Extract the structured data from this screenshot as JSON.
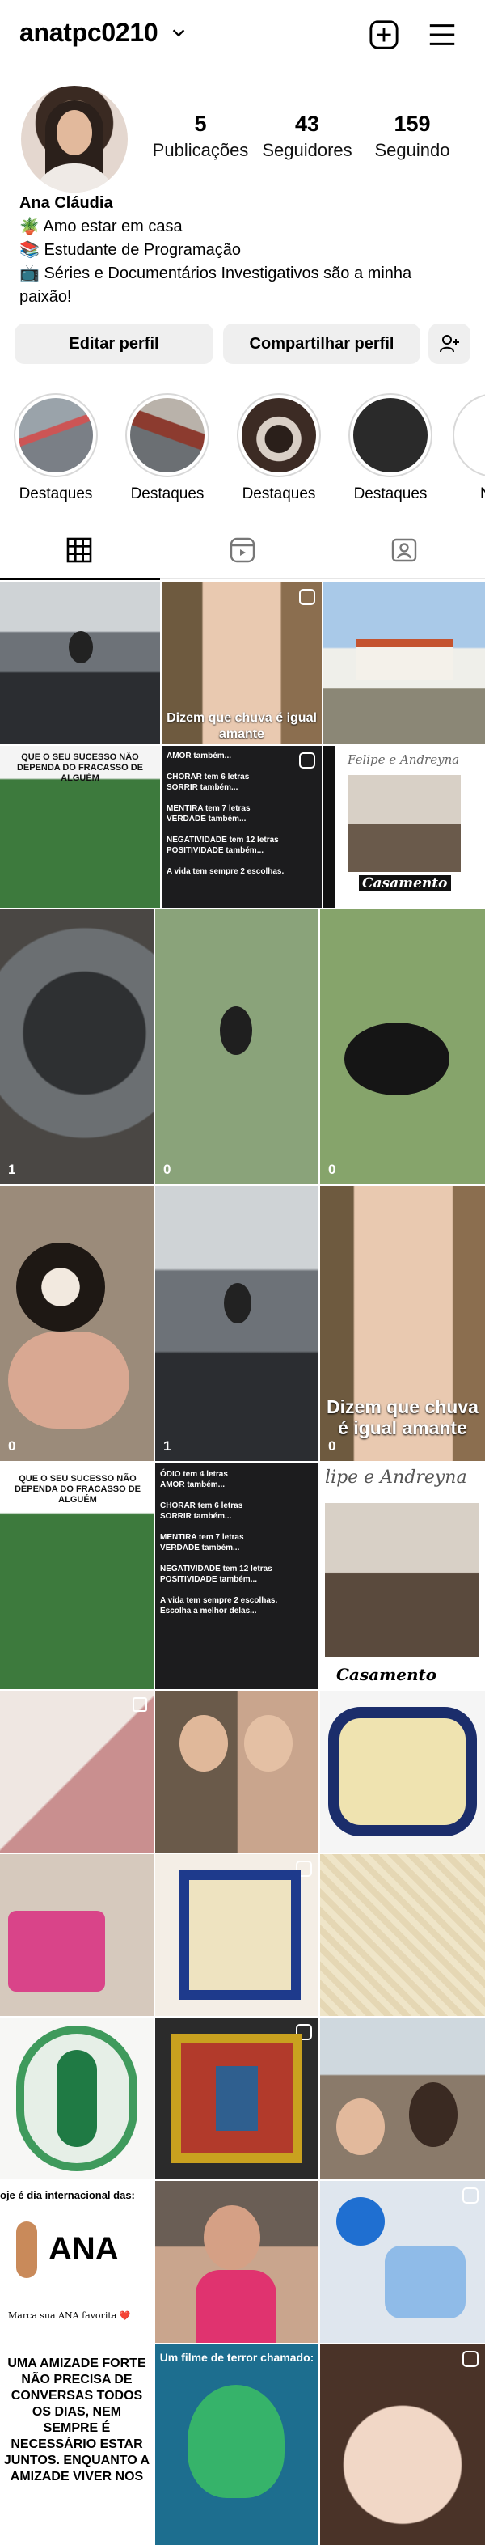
{
  "profile": {
    "username": "anatpc0210",
    "full_name": "Ana Cláudia",
    "bio_lines": [
      "🪴 Amo estar em casa",
      "📚 Estudante de Programação",
      "📺 Séries e Documentários Investigativos são a minha",
      "paixão!"
    ],
    "stats": {
      "posts": {
        "value": "5",
        "label": "Publicações"
      },
      "followers": {
        "value": "43",
        "label": "Seguidores"
      },
      "following": {
        "value": "159",
        "label": "Seguindo"
      }
    }
  },
  "actions": {
    "edit_profile": "Editar perfil",
    "share_profile": "Compartilhar perfil"
  },
  "highlights": [
    {
      "label": "Destaques"
    },
    {
      "label": "Destaques"
    },
    {
      "label": "Destaques"
    },
    {
      "label": "Destaques"
    },
    {
      "label": "N"
    }
  ],
  "posts": {
    "captions": {
      "chuva": "Dizem que chuva é igual amante",
      "chuva_large": "Dizem que chuva é igual amante",
      "sucesso": "QUE O SEU SUCESSO NÃO DEPENDA DO FRACASSO DE ALGUÉM",
      "amor_lines": "AMOR também...\n\nCHORAR tem 6 letras\nSORRIR também...\n\nMENTIRA tem 7 letras\nVERDADE também...\n\nNEGATIVIDADE tem 12 letras\nPOSITIVIDADE também...\n\nA vida tem sempre 2 escolhas.",
      "amor_lines2": "ÓDIO tem 4 letras\nAMOR também...\n\nCHORAR tem 6 letras\nSORRIR também...\n\nMENTIRA tem 7 letras\nVERDADE também...\n\nNEGATIVIDADE tem 12 letras\nPOSITIVIDADE também...\n\nA vida tem sempre 2 escolhas.\nEscolha a melhor delas...",
      "casamento_top": "Felipe e Andreyna",
      "casamento": "Casamento",
      "casamento_top2": "lipe e Andreyna",
      "ana_title": "oje é dia internacional das:",
      "ana_name": "ANA",
      "ana_sub": "Marca sua ANA favorita ❤️",
      "amizade": "UMA AMIZADE FORTE NÃO PRECISA DE CONVERSAS TODOS OS DIAS, NEM SEMPRE É NECESSÁRIO ESTAR JUNTOS. ENQUANTO A AMIZADE VIVER NOS",
      "terror": "Um filme de terror chamado:"
    },
    "counts": [
      "1",
      "0",
      "0",
      "0",
      "1",
      "0"
    ]
  }
}
